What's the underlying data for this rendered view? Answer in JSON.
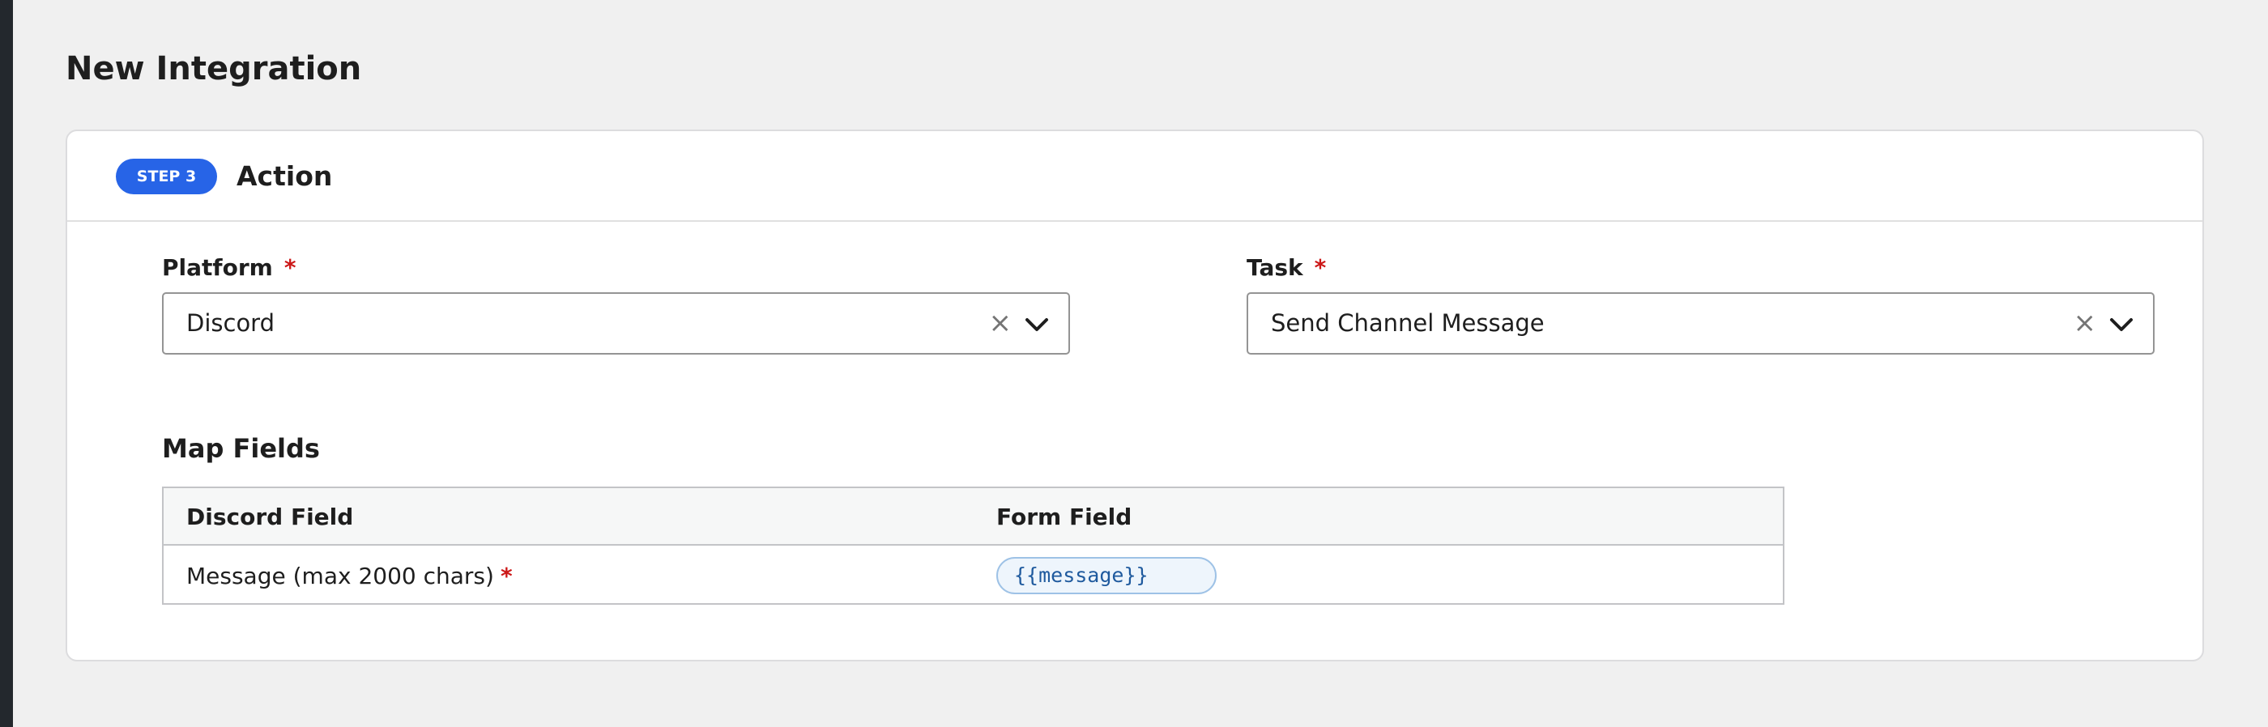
{
  "page": {
    "title": "New Integration"
  },
  "step": {
    "badge": "STEP 3",
    "title": "Action"
  },
  "platform": {
    "label": "Platform",
    "required_mark": "*",
    "value": "Discord",
    "clear_glyph": "×",
    "icons": [
      "clear-icon",
      "chevron-down-icon"
    ]
  },
  "task": {
    "label": "Task",
    "required_mark": "*",
    "value": "Send Channel Message",
    "clear_glyph": "×",
    "icons": [
      "clear-icon",
      "chevron-down-icon"
    ]
  },
  "map_fields": {
    "title": "Map Fields",
    "columns": [
      "Discord Field",
      "Form Field"
    ],
    "rows": [
      {
        "field": "Message (max 2000 chars)",
        "required_mark": "*",
        "tag": "{{message}}"
      }
    ]
  },
  "colors": {
    "accent": "#2764e7",
    "required": "#cc1818",
    "page_bg": "#f0f0f0",
    "card_bg": "#ffffff",
    "tag_text": "#1f5a9e"
  }
}
